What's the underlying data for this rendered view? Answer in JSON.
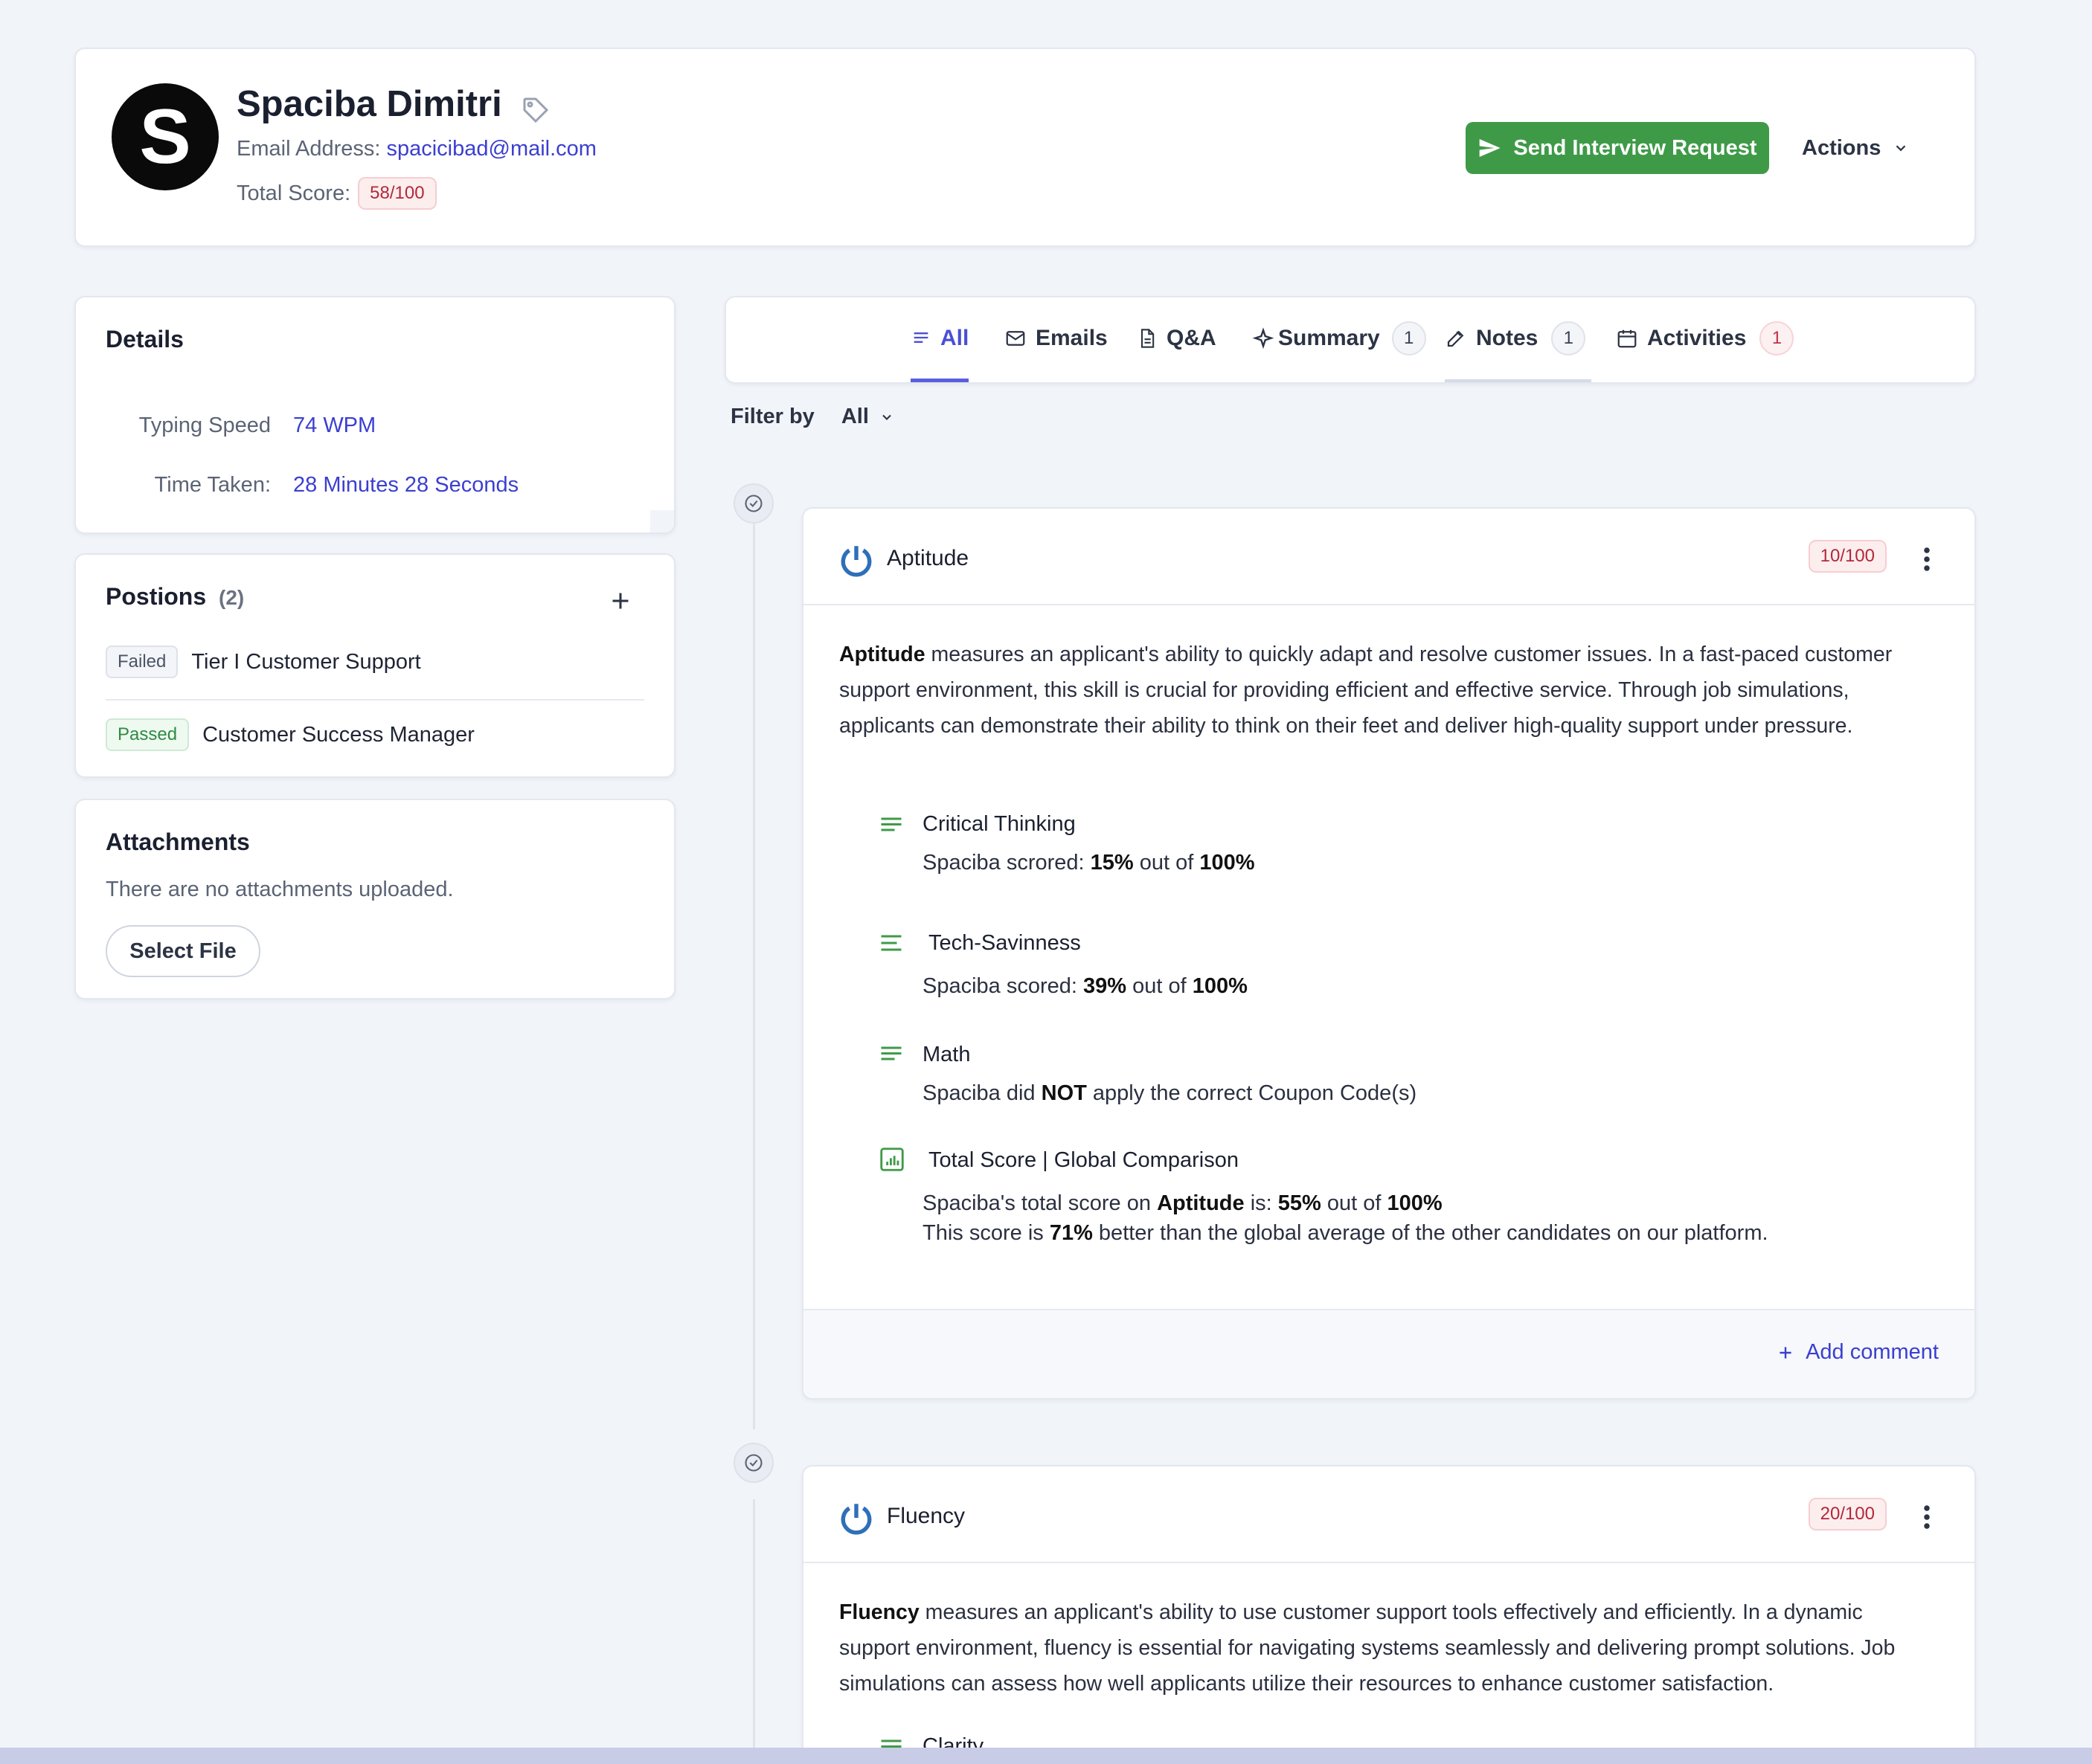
{
  "header": {
    "avatar_letter": "S",
    "name": "Spaciba Dimitri",
    "email_label": "Email Address:",
    "email": "spacicibad@mail.com",
    "score_label": "Total Score:",
    "score": "58/100",
    "send_button": "Send Interview Request",
    "actions_button": "Actions"
  },
  "details": {
    "title": "Details",
    "typing_label": "Typing Speed",
    "typing_value": "74 WPM",
    "time_label": "Time Taken:",
    "time_value": "28 Minutes 28 Seconds"
  },
  "positions": {
    "title": "Postions",
    "count": "(2)",
    "items": [
      {
        "status": "Failed",
        "name": "Tier I Customer Support"
      },
      {
        "status": "Passed",
        "name": "Customer Success Manager"
      }
    ]
  },
  "attachments": {
    "title": "Attachments",
    "empty_text": "There are no attachments uploaded.",
    "button": "Select File"
  },
  "tabs": [
    {
      "label": "All",
      "count": null
    },
    {
      "label": "Emails",
      "count": null
    },
    {
      "label": "Q&A",
      "count": null
    },
    {
      "label": "Summary",
      "count": "1"
    },
    {
      "label": "Notes",
      "count": "1"
    },
    {
      "label": "Activities",
      "count": "1"
    }
  ],
  "filter": {
    "label": "Filter by",
    "value": "All"
  },
  "aptitude": {
    "title": "Aptitude",
    "score": "10/100",
    "desc_bold": "Aptitude",
    "desc_rest": " measures an applicant's ability to quickly adapt and resolve customer issues. In a fast-paced customer support environment, this skill is crucial for providing efficient and effective service. Through job simulations, applicants can demonstrate their ability to think on their feet and deliver high-quality support under pressure.",
    "metrics": [
      {
        "title": "Critical Thinking",
        "pre": "Spaciba scrored: ",
        "pct": "15%",
        "mid": " out of ",
        "max": "100%"
      },
      {
        "title": "Tech-Savinness",
        "pre": "Spaciba scored: ",
        "pct": "39%",
        "mid": " out of ",
        "max": "100%"
      },
      {
        "title": "Math",
        "pre": "Spaciba did ",
        "bold": "NOT",
        "post": " apply the correct Coupon Code(s)"
      }
    ],
    "total": {
      "title": "Total Score | Global Comparison",
      "line1_pre": "Spaciba's total score on ",
      "line1_bold": "Aptitude",
      "line1_mid": " is: ",
      "line1_pct": "55%",
      "line1_mid2": " out of ",
      "line1_max": "100%",
      "line2_pre": "This score is ",
      "line2_pct": "71%",
      "line2_post": " better than the global average of the other candidates on our platform."
    },
    "add_comment": "Add comment"
  },
  "fluency": {
    "title": "Fluency",
    "score": "20/100",
    "desc_bold": "Fluency",
    "desc_rest": " measures an applicant's ability to use customer support tools effectively and efficiently. In a dynamic support environment, fluency is essential for navigating systems seamlessly and delivering prompt solutions. Job simulations can assess how well applicants utilize their resources to enhance customer satisfaction.",
    "next_metric": "Clarity"
  },
  "colors": {
    "accent": "#4a4fd6",
    "link": "#3b3fd0",
    "success": "#3f9a48",
    "danger": "#b3283a",
    "background": "#f1f4f9"
  }
}
